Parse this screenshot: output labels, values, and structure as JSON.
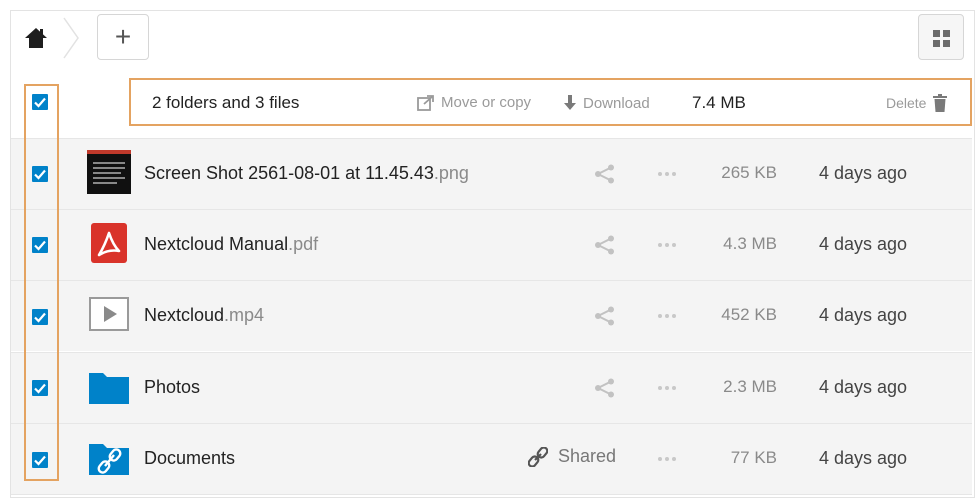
{
  "toolbar": {
    "home_icon": "home-icon",
    "add_label": "+",
    "view_toggle_icon": "grid-view-icon"
  },
  "selection": {
    "summary": "2 folders and 3 files",
    "move_copy_label": "Move or copy",
    "download_label": "Download",
    "total_size": "7.4 MB",
    "delete_label": "Delete"
  },
  "files": [
    {
      "name": "Screen Shot 2561-08-01 at 11.45.43",
      "ext": ".png",
      "size": "265 KB",
      "modified": "4 days ago",
      "icon": "image-thumbnail",
      "selected": true
    },
    {
      "name": "Nextcloud Manual",
      "ext": ".pdf",
      "size": "4.3 MB",
      "modified": "4 days ago",
      "icon": "pdf-icon",
      "selected": true
    },
    {
      "name": "Nextcloud",
      "ext": ".mp4",
      "size": "452 KB",
      "modified": "4 days ago",
      "icon": "video-icon",
      "selected": true
    },
    {
      "name": "Photos",
      "ext": "",
      "size": "2.3 MB",
      "modified": "4 days ago",
      "icon": "folder-icon",
      "selected": true
    },
    {
      "name": "Documents",
      "ext": "",
      "size": "77 KB",
      "modified": "4 days ago",
      "icon": "shared-folder-icon",
      "selected": true,
      "shared_label": "Shared"
    }
  ],
  "colors": {
    "accent": "#0082c9",
    "highlight": "#e4a361",
    "row_bg": "#f4f4f4"
  }
}
